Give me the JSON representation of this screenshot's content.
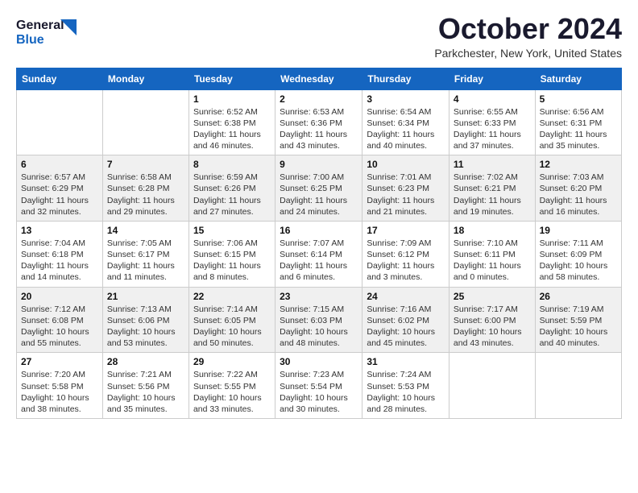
{
  "header": {
    "logo_line1": "General",
    "logo_line2": "Blue",
    "month_title": "October 2024",
    "location": "Parkchester, New York, United States"
  },
  "days_of_week": [
    "Sunday",
    "Monday",
    "Tuesday",
    "Wednesday",
    "Thursday",
    "Friday",
    "Saturday"
  ],
  "weeks": [
    [
      {
        "day": "",
        "info": ""
      },
      {
        "day": "",
        "info": ""
      },
      {
        "day": "1",
        "info": "Sunrise: 6:52 AM\nSunset: 6:38 PM\nDaylight: 11 hours and 46 minutes."
      },
      {
        "day": "2",
        "info": "Sunrise: 6:53 AM\nSunset: 6:36 PM\nDaylight: 11 hours and 43 minutes."
      },
      {
        "day": "3",
        "info": "Sunrise: 6:54 AM\nSunset: 6:34 PM\nDaylight: 11 hours and 40 minutes."
      },
      {
        "day": "4",
        "info": "Sunrise: 6:55 AM\nSunset: 6:33 PM\nDaylight: 11 hours and 37 minutes."
      },
      {
        "day": "5",
        "info": "Sunrise: 6:56 AM\nSunset: 6:31 PM\nDaylight: 11 hours and 35 minutes."
      }
    ],
    [
      {
        "day": "6",
        "info": "Sunrise: 6:57 AM\nSunset: 6:29 PM\nDaylight: 11 hours and 32 minutes."
      },
      {
        "day": "7",
        "info": "Sunrise: 6:58 AM\nSunset: 6:28 PM\nDaylight: 11 hours and 29 minutes."
      },
      {
        "day": "8",
        "info": "Sunrise: 6:59 AM\nSunset: 6:26 PM\nDaylight: 11 hours and 27 minutes."
      },
      {
        "day": "9",
        "info": "Sunrise: 7:00 AM\nSunset: 6:25 PM\nDaylight: 11 hours and 24 minutes."
      },
      {
        "day": "10",
        "info": "Sunrise: 7:01 AM\nSunset: 6:23 PM\nDaylight: 11 hours and 21 minutes."
      },
      {
        "day": "11",
        "info": "Sunrise: 7:02 AM\nSunset: 6:21 PM\nDaylight: 11 hours and 19 minutes."
      },
      {
        "day": "12",
        "info": "Sunrise: 7:03 AM\nSunset: 6:20 PM\nDaylight: 11 hours and 16 minutes."
      }
    ],
    [
      {
        "day": "13",
        "info": "Sunrise: 7:04 AM\nSunset: 6:18 PM\nDaylight: 11 hours and 14 minutes."
      },
      {
        "day": "14",
        "info": "Sunrise: 7:05 AM\nSunset: 6:17 PM\nDaylight: 11 hours and 11 minutes."
      },
      {
        "day": "15",
        "info": "Sunrise: 7:06 AM\nSunset: 6:15 PM\nDaylight: 11 hours and 8 minutes."
      },
      {
        "day": "16",
        "info": "Sunrise: 7:07 AM\nSunset: 6:14 PM\nDaylight: 11 hours and 6 minutes."
      },
      {
        "day": "17",
        "info": "Sunrise: 7:09 AM\nSunset: 6:12 PM\nDaylight: 11 hours and 3 minutes."
      },
      {
        "day": "18",
        "info": "Sunrise: 7:10 AM\nSunset: 6:11 PM\nDaylight: 11 hours and 0 minutes."
      },
      {
        "day": "19",
        "info": "Sunrise: 7:11 AM\nSunset: 6:09 PM\nDaylight: 10 hours and 58 minutes."
      }
    ],
    [
      {
        "day": "20",
        "info": "Sunrise: 7:12 AM\nSunset: 6:08 PM\nDaylight: 10 hours and 55 minutes."
      },
      {
        "day": "21",
        "info": "Sunrise: 7:13 AM\nSunset: 6:06 PM\nDaylight: 10 hours and 53 minutes."
      },
      {
        "day": "22",
        "info": "Sunrise: 7:14 AM\nSunset: 6:05 PM\nDaylight: 10 hours and 50 minutes."
      },
      {
        "day": "23",
        "info": "Sunrise: 7:15 AM\nSunset: 6:03 PM\nDaylight: 10 hours and 48 minutes."
      },
      {
        "day": "24",
        "info": "Sunrise: 7:16 AM\nSunset: 6:02 PM\nDaylight: 10 hours and 45 minutes."
      },
      {
        "day": "25",
        "info": "Sunrise: 7:17 AM\nSunset: 6:00 PM\nDaylight: 10 hours and 43 minutes."
      },
      {
        "day": "26",
        "info": "Sunrise: 7:19 AM\nSunset: 5:59 PM\nDaylight: 10 hours and 40 minutes."
      }
    ],
    [
      {
        "day": "27",
        "info": "Sunrise: 7:20 AM\nSunset: 5:58 PM\nDaylight: 10 hours and 38 minutes."
      },
      {
        "day": "28",
        "info": "Sunrise: 7:21 AM\nSunset: 5:56 PM\nDaylight: 10 hours and 35 minutes."
      },
      {
        "day": "29",
        "info": "Sunrise: 7:22 AM\nSunset: 5:55 PM\nDaylight: 10 hours and 33 minutes."
      },
      {
        "day": "30",
        "info": "Sunrise: 7:23 AM\nSunset: 5:54 PM\nDaylight: 10 hours and 30 minutes."
      },
      {
        "day": "31",
        "info": "Sunrise: 7:24 AM\nSunset: 5:53 PM\nDaylight: 10 hours and 28 minutes."
      },
      {
        "day": "",
        "info": ""
      },
      {
        "day": "",
        "info": ""
      }
    ]
  ]
}
